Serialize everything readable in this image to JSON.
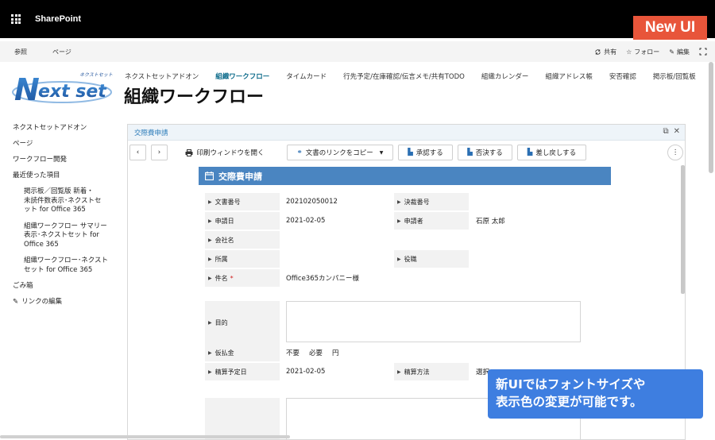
{
  "topbar": {
    "app_name": "SharePoint",
    "badge": "New UI"
  },
  "commandbar": {
    "left": [
      "参照",
      "ページ"
    ],
    "right": [
      {
        "icon": "sync-icon",
        "label": "共有"
      },
      {
        "icon": "star-icon",
        "label": "フォロー"
      },
      {
        "icon": "pencil-icon",
        "label": "編集"
      }
    ]
  },
  "logo": {
    "text": "Nextset",
    "subtext": "ネクストセット"
  },
  "topnav": [
    "ネクストセットアドオン",
    "組織ワークフロー",
    "タイムカード",
    "行先予定/在庫確認/伝言メモ/共有TODO",
    "組織カレンダー",
    "組織アドレス帳",
    "安否確認",
    "掲示板/回覧板"
  ],
  "site_title": "組織ワークフロー",
  "leftnav": {
    "items": [
      "ネクストセットアドオン",
      "ページ",
      "ワークフロー開発",
      "最近使った項目"
    ],
    "recent": [
      [
        "掲示板／回覧版 新着・",
        "未読件数表示･ネクストセ",
        "ット for Office 365"
      ],
      [
        "組織ワークフロー サマリー",
        "表示･ネクストセット for",
        "Office 365"
      ],
      [
        "組織ワークフロー･ネクスト",
        "セット for Office 365"
      ]
    ],
    "trash": "ごみ箱",
    "edit_links": "リンクの編集"
  },
  "panel": {
    "title": "交際費申請",
    "toolbar": {
      "print": "印刷ウィンドウを開く",
      "copy_link": "文書のリンクをコピー",
      "approve": "承認する",
      "reject": "否決する",
      "return": "差し戻しする"
    },
    "form_title": "交際費申請",
    "fields": {
      "doc_no": {
        "label": "文書番号",
        "value": "202102050012"
      },
      "decision_no": {
        "label": "決裁番号",
        "value": ""
      },
      "apply_date": {
        "label": "申請日",
        "value": "2021-02-05"
      },
      "applicant": {
        "label": "申請者",
        "value": "石原 太郎"
      },
      "company": {
        "label": "会社名",
        "value": ""
      },
      "dept": {
        "label": "所属",
        "value": ""
      },
      "role": {
        "label": "役職",
        "value": ""
      },
      "subject": {
        "label": "件名",
        "required": "*",
        "value": "Office365カンパニー様"
      },
      "purpose": {
        "label": "目的",
        "value": ""
      },
      "advance": {
        "label": "仮払金",
        "options": [
          "不要",
          "必要"
        ],
        "unit": "円"
      },
      "settle_date": {
        "label": "精算予定日",
        "value": "2021-02-05"
      },
      "settle_method": {
        "label": "精算方法",
        "value": "選択"
      }
    }
  },
  "callout": {
    "line1": "新UIではフォントサイズや",
    "line2": "表示色の変更が可能です。"
  }
}
